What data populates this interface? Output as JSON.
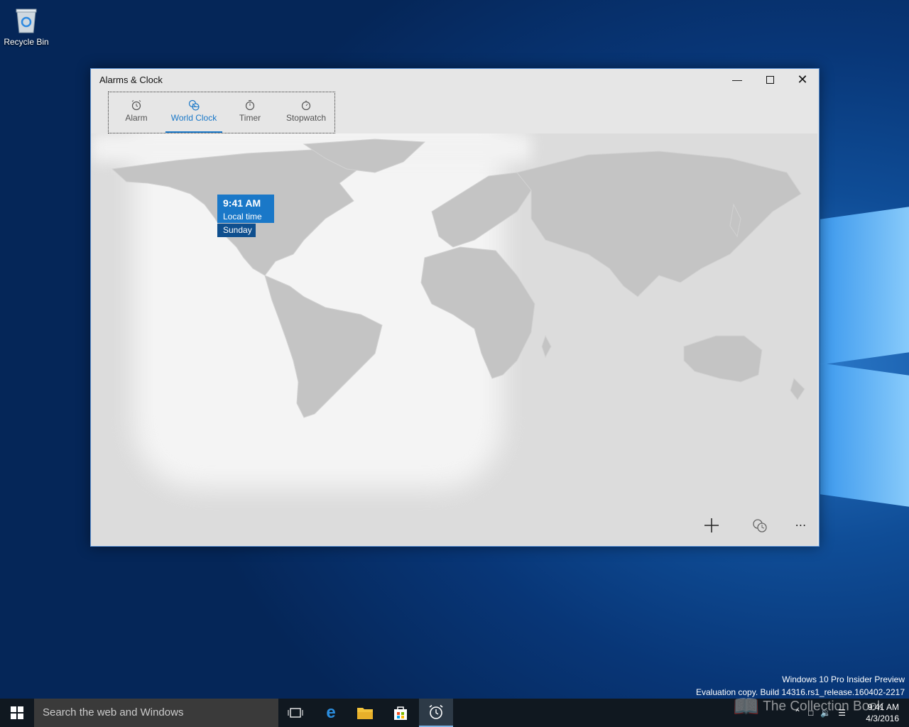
{
  "desktop": {
    "recycle_bin_label": "Recycle Bin"
  },
  "window": {
    "title": "Alarms & Clock",
    "tabs": [
      {
        "label": "Alarm",
        "icon": "alarm-clock-icon"
      },
      {
        "label": "World Clock",
        "icon": "world-clock-icon",
        "active": true
      },
      {
        "label": "Timer",
        "icon": "timer-icon"
      },
      {
        "label": "Stopwatch",
        "icon": "stopwatch-icon"
      }
    ],
    "accent_color": "#1a78c8"
  },
  "world_clock": {
    "local_time": "9:41 AM",
    "local_label": "Local time",
    "day": "Sunday"
  },
  "watermark": {
    "line1": "Windows 10 Pro Insider Preview",
    "line2": "Evaluation copy. Build 14316.rs1_release.160402-2217"
  },
  "taskbar": {
    "search_placeholder": "Search the web and Windows",
    "clock_time": "9:41 AM",
    "clock_date": "4/3/2016"
  },
  "overlay": {
    "text": "The Collection Book"
  }
}
